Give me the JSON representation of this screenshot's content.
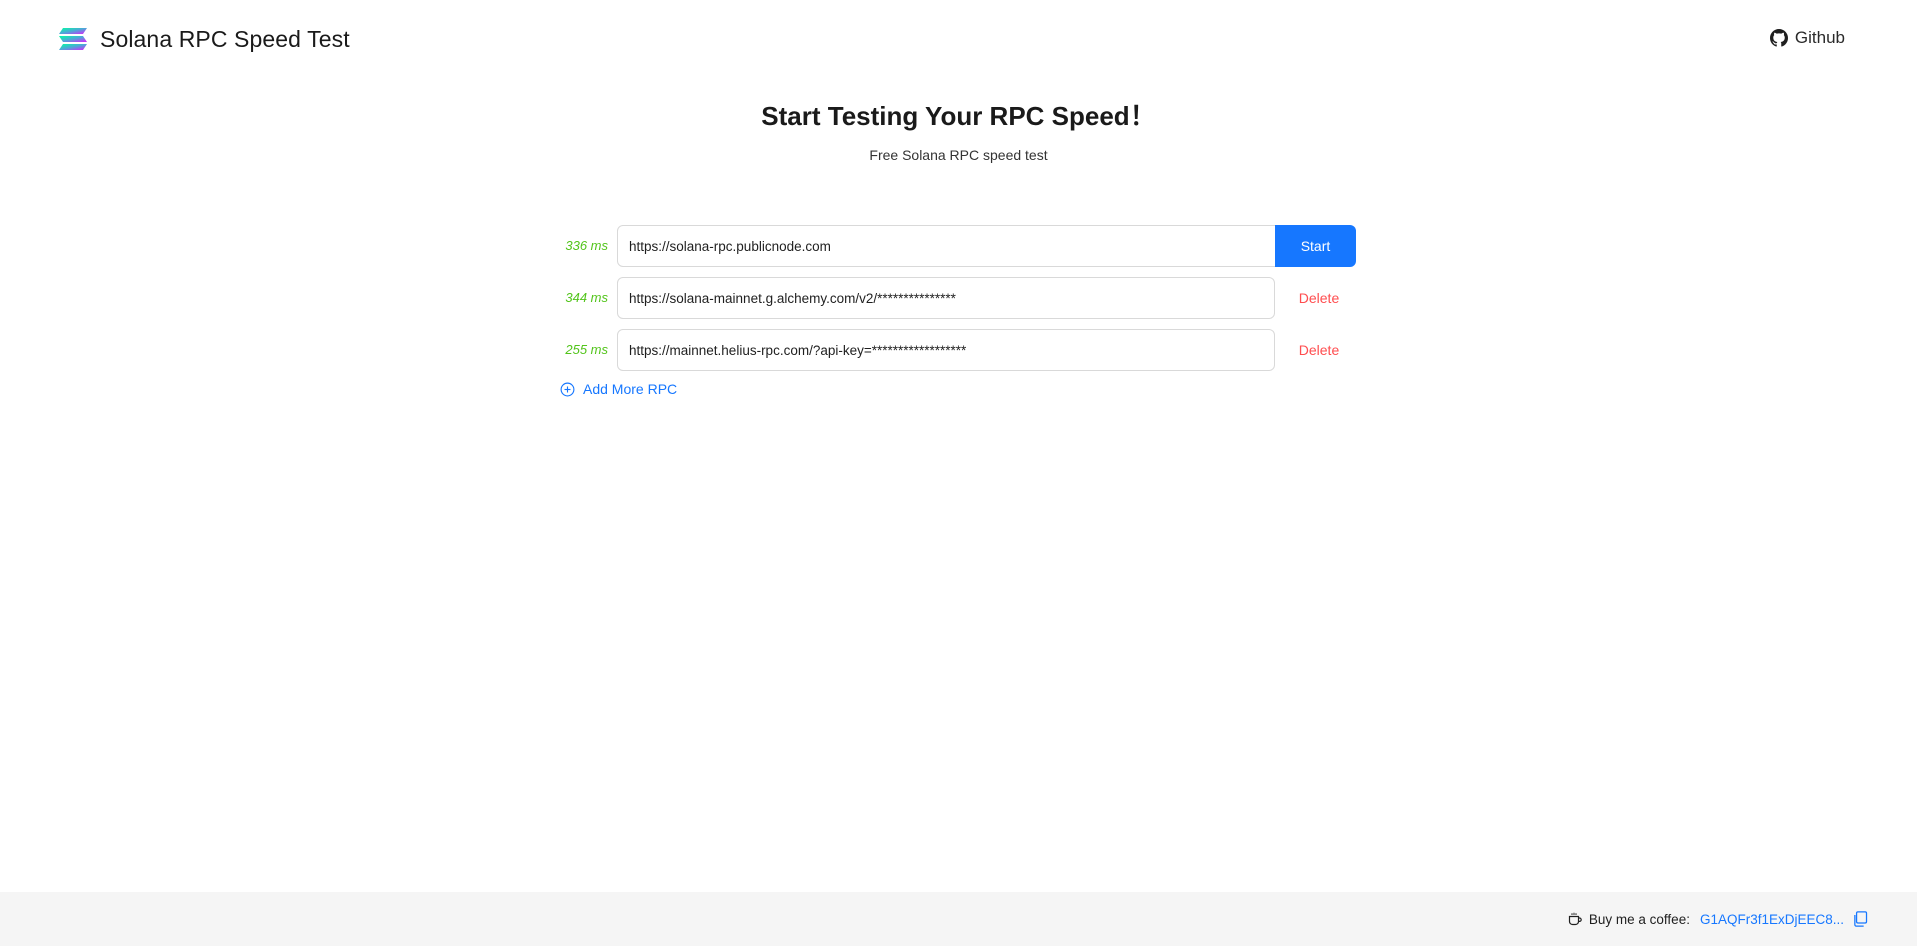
{
  "header": {
    "logo_icon": "solana-logo-icon",
    "title": "Solana RPC Speed Test",
    "github_icon": "github-icon",
    "github_label": "Github"
  },
  "hero": {
    "title": "Start Testing Your RPC Speed！",
    "subtitle": "Free Solana RPC speed test"
  },
  "rpc_list": [
    {
      "latency": "336 ms",
      "url": "https://solana-rpc.publicnode.com",
      "action": "Start"
    },
    {
      "latency": "344 ms",
      "url": "https://solana-mainnet.g.alchemy.com/v2/***************",
      "action": "Delete"
    },
    {
      "latency": "255 ms",
      "url": "https://mainnet.helius-rpc.com/?api-key=******************",
      "action": "Delete"
    }
  ],
  "add_more": {
    "icon": "plus-circle-icon",
    "label": "Add More RPC"
  },
  "footer": {
    "coffee_icon": "coffee-cup-icon",
    "coffee_label": "Buy me a coffee:",
    "address": "G1AQFr3f1ExDjEEC8...",
    "copy_icon": "copy-icon"
  },
  "colors": {
    "primary": "#1677ff",
    "latency": "#52c41a",
    "danger": "#ff4d4f",
    "footer_bg": "#f5f5f5"
  }
}
